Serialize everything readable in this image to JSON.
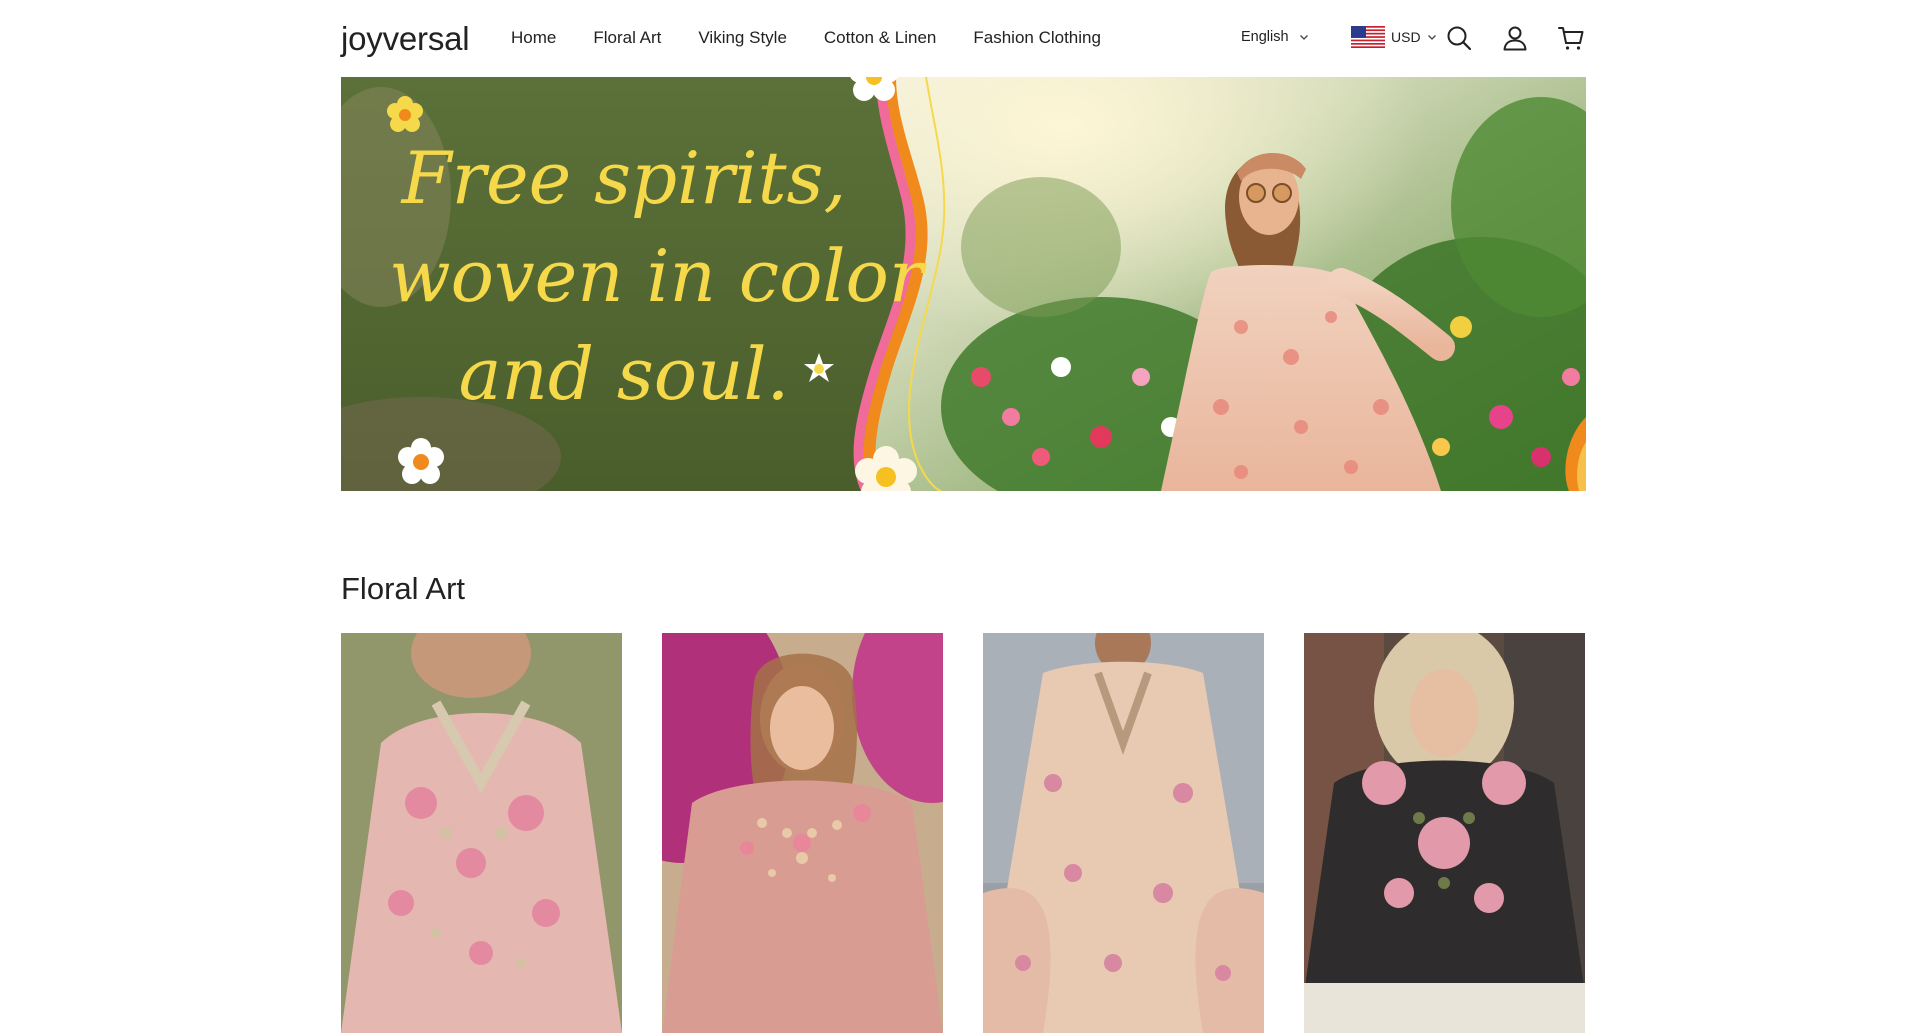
{
  "header": {
    "logo": "joyversal",
    "nav": [
      "Home",
      "Floral Art",
      "Viking Style",
      "Cotton & Linen",
      "Fashion Clothing"
    ],
    "language": "English",
    "currency": "USD"
  },
  "hero": {
    "lines": [
      "Free spirits,",
      "woven in color",
      "and soul."
    ]
  },
  "sections": [
    {
      "title": "Floral Art"
    }
  ],
  "colors": {
    "hero_text": "#f6d94a",
    "hero_green": "#4f6a32",
    "accent_orange": "#f08a1c",
    "accent_pink": "#f06a9a"
  }
}
